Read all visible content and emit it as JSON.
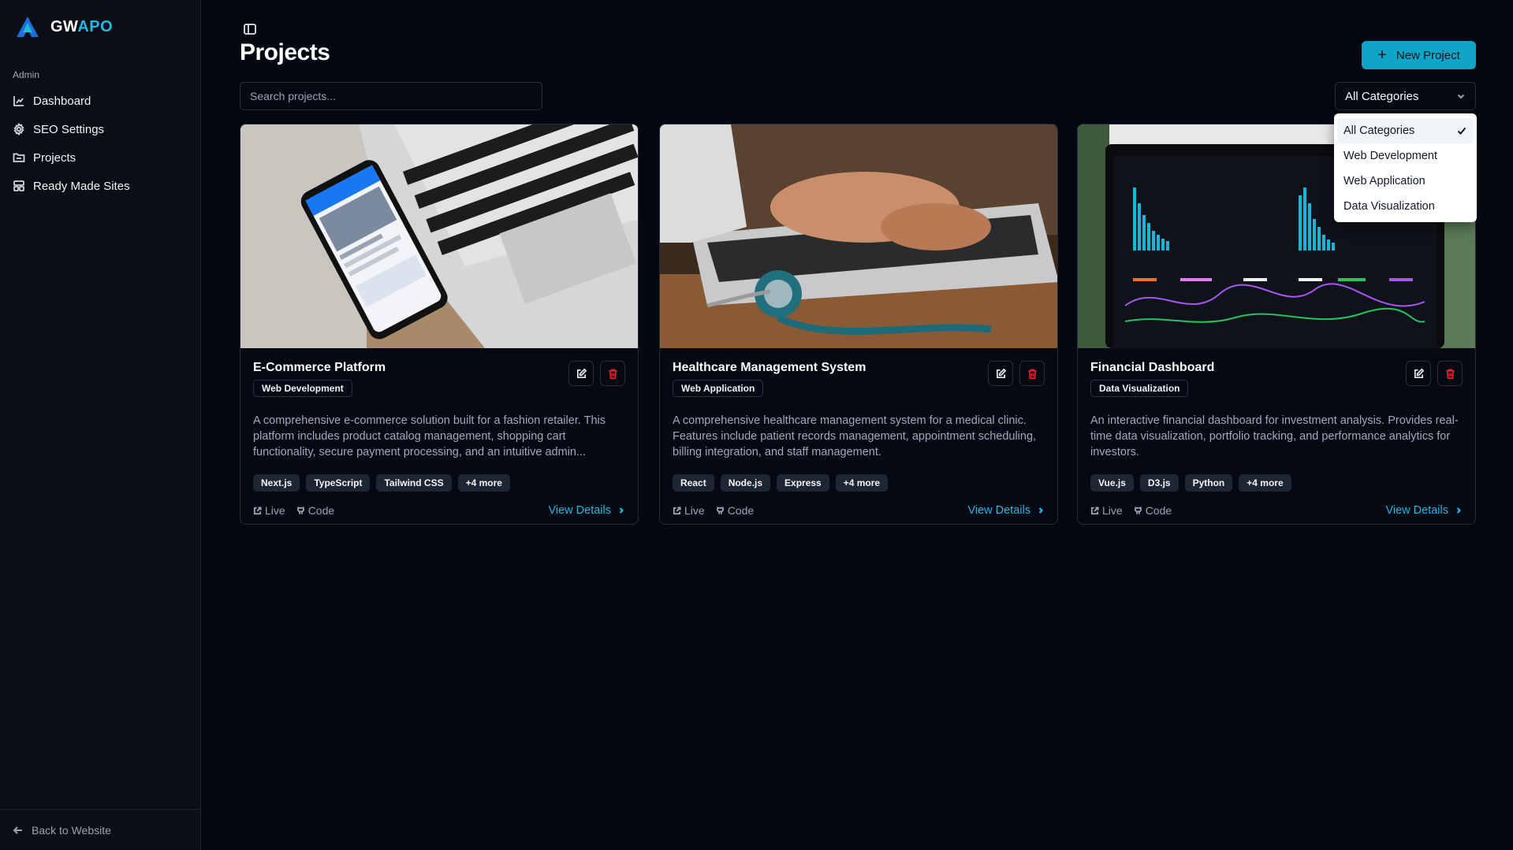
{
  "brand": {
    "name_part1": "GW",
    "name_part2": "APO"
  },
  "sidebar": {
    "section_label": "Admin",
    "items": [
      {
        "label": "Dashboard",
        "icon": "chart-icon"
      },
      {
        "label": "SEO Settings",
        "icon": "gear-icon"
      },
      {
        "label": "Projects",
        "icon": "folder-icon"
      },
      {
        "label": "Ready Made Sites",
        "icon": "layout-icon"
      }
    ],
    "back_label": "Back to Website"
  },
  "header": {
    "title": "Projects",
    "new_button_label": "New Project"
  },
  "search": {
    "placeholder": "Search projects...",
    "value": ""
  },
  "filter": {
    "selected": "All Categories",
    "options": [
      "All Categories",
      "Web Development",
      "Web Application",
      "Data Visualization"
    ]
  },
  "projects": [
    {
      "title": "E-Commerce Platform",
      "category": "Web Development",
      "description": "A comprehensive e-commerce solution built for a fashion retailer. This platform includes product catalog management, shopping cart functionality, secure payment processing, and an intuitive admin...",
      "tags": [
        "Next.js",
        "TypeScript",
        "Tailwind CSS",
        "+4 more"
      ],
      "live_label": "Live",
      "code_label": "Code",
      "details_label": "View Details"
    },
    {
      "title": "Healthcare Management System",
      "category": "Web Application",
      "description": "A comprehensive healthcare management system for a medical clinic. Features include patient records management, appointment scheduling, billing integration, and staff management.",
      "tags": [
        "React",
        "Node.js",
        "Express",
        "+4 more"
      ],
      "live_label": "Live",
      "code_label": "Code",
      "details_label": "View Details"
    },
    {
      "title": "Financial Dashboard",
      "category": "Data Visualization",
      "description": "An interactive financial dashboard for investment analysis. Provides real-time data visualization, portfolio tracking, and performance analytics for investors.",
      "tags": [
        "Vue.js",
        "D3.js",
        "Python",
        "+4 more"
      ],
      "live_label": "Live",
      "code_label": "Code",
      "details_label": "View Details"
    }
  ],
  "colors": {
    "accent": "#0ea5c6",
    "link": "#22b8e0",
    "danger": "#dc2626",
    "background": "#030712"
  }
}
